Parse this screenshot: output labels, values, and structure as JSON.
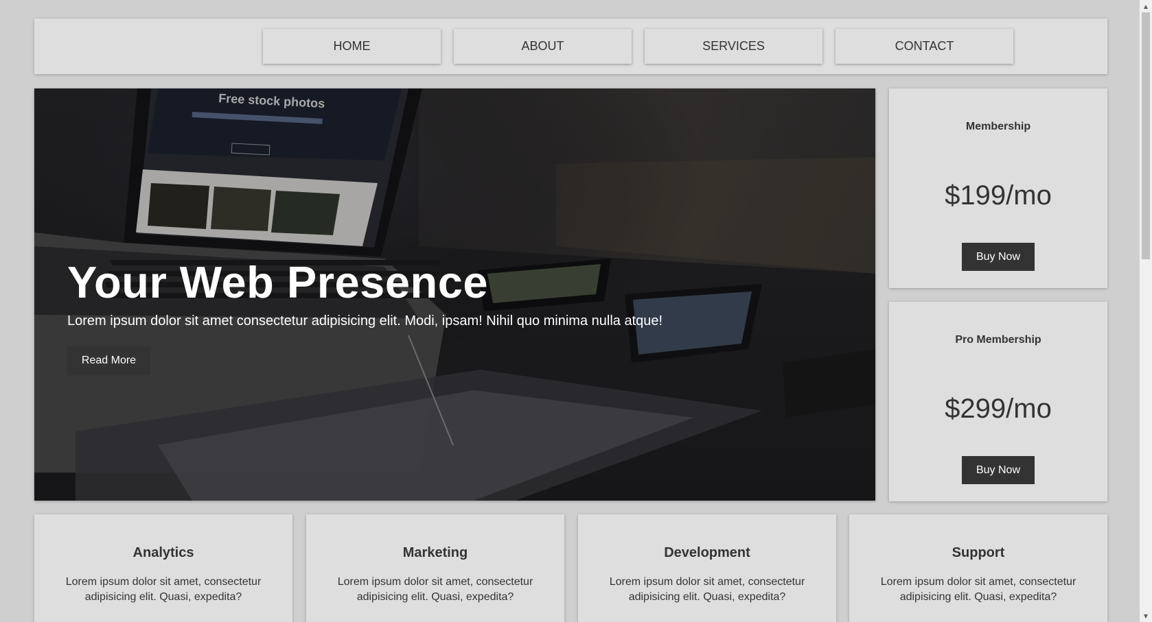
{
  "nav": {
    "items": [
      "HOME",
      "ABOUT",
      "SERVICES",
      "CONTACT"
    ]
  },
  "hero": {
    "title": "Your Web Presence",
    "text": "Lorem ipsum dolor sit amet consectetur adipisicing elit. Modi, ipsam! Nihil quo minima nulla atque!",
    "button_label": "Read More",
    "image_caption": "Free stock photos"
  },
  "pricing": [
    {
      "title": "Membership",
      "price": "$199/mo",
      "button_label": "Buy Now"
    },
    {
      "title": "Pro Membership",
      "price": "$299/mo",
      "button_label": "Buy Now"
    }
  ],
  "features": [
    {
      "title": "Analytics",
      "text": "Lorem ipsum dolor sit amet, consectetur adipisicing elit. Quasi, expedita?"
    },
    {
      "title": "Marketing",
      "text": "Lorem ipsum dolor sit amet, consectetur adipisicing elit. Quasi, expedita?"
    },
    {
      "title": "Development",
      "text": "Lorem ipsum dolor sit amet, consectetur adipisicing elit. Quasi, expedita?"
    },
    {
      "title": "Support",
      "text": "Lorem ipsum dolor sit amet, consectetur adipisicing elit. Quasi, expedita?"
    }
  ],
  "colors": {
    "page_bg": "#cfcfcf",
    "panel_bg": "#dedede",
    "button_dark": "#333333",
    "text": "#333333"
  },
  "scrollbar": {
    "up_icon": "triangle-up-icon",
    "down_icon": "triangle-down-icon"
  }
}
